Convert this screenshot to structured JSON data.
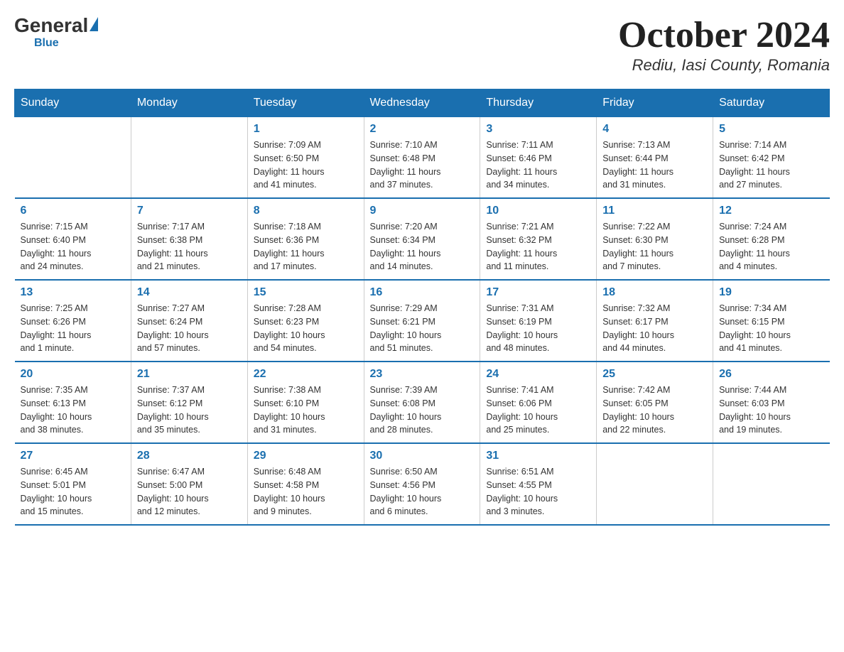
{
  "header": {
    "logo_general": "General",
    "logo_blue": "Blue",
    "month_title": "October 2024",
    "location": "Rediu, Iasi County, Romania"
  },
  "days_of_week": [
    "Sunday",
    "Monday",
    "Tuesday",
    "Wednesday",
    "Thursday",
    "Friday",
    "Saturday"
  ],
  "weeks": [
    [
      {
        "day": "",
        "info": ""
      },
      {
        "day": "",
        "info": ""
      },
      {
        "day": "1",
        "info": "Sunrise: 7:09 AM\nSunset: 6:50 PM\nDaylight: 11 hours\nand 41 minutes."
      },
      {
        "day": "2",
        "info": "Sunrise: 7:10 AM\nSunset: 6:48 PM\nDaylight: 11 hours\nand 37 minutes."
      },
      {
        "day": "3",
        "info": "Sunrise: 7:11 AM\nSunset: 6:46 PM\nDaylight: 11 hours\nand 34 minutes."
      },
      {
        "day": "4",
        "info": "Sunrise: 7:13 AM\nSunset: 6:44 PM\nDaylight: 11 hours\nand 31 minutes."
      },
      {
        "day": "5",
        "info": "Sunrise: 7:14 AM\nSunset: 6:42 PM\nDaylight: 11 hours\nand 27 minutes."
      }
    ],
    [
      {
        "day": "6",
        "info": "Sunrise: 7:15 AM\nSunset: 6:40 PM\nDaylight: 11 hours\nand 24 minutes."
      },
      {
        "day": "7",
        "info": "Sunrise: 7:17 AM\nSunset: 6:38 PM\nDaylight: 11 hours\nand 21 minutes."
      },
      {
        "day": "8",
        "info": "Sunrise: 7:18 AM\nSunset: 6:36 PM\nDaylight: 11 hours\nand 17 minutes."
      },
      {
        "day": "9",
        "info": "Sunrise: 7:20 AM\nSunset: 6:34 PM\nDaylight: 11 hours\nand 14 minutes."
      },
      {
        "day": "10",
        "info": "Sunrise: 7:21 AM\nSunset: 6:32 PM\nDaylight: 11 hours\nand 11 minutes."
      },
      {
        "day": "11",
        "info": "Sunrise: 7:22 AM\nSunset: 6:30 PM\nDaylight: 11 hours\nand 7 minutes."
      },
      {
        "day": "12",
        "info": "Sunrise: 7:24 AM\nSunset: 6:28 PM\nDaylight: 11 hours\nand 4 minutes."
      }
    ],
    [
      {
        "day": "13",
        "info": "Sunrise: 7:25 AM\nSunset: 6:26 PM\nDaylight: 11 hours\nand 1 minute."
      },
      {
        "day": "14",
        "info": "Sunrise: 7:27 AM\nSunset: 6:24 PM\nDaylight: 10 hours\nand 57 minutes."
      },
      {
        "day": "15",
        "info": "Sunrise: 7:28 AM\nSunset: 6:23 PM\nDaylight: 10 hours\nand 54 minutes."
      },
      {
        "day": "16",
        "info": "Sunrise: 7:29 AM\nSunset: 6:21 PM\nDaylight: 10 hours\nand 51 minutes."
      },
      {
        "day": "17",
        "info": "Sunrise: 7:31 AM\nSunset: 6:19 PM\nDaylight: 10 hours\nand 48 minutes."
      },
      {
        "day": "18",
        "info": "Sunrise: 7:32 AM\nSunset: 6:17 PM\nDaylight: 10 hours\nand 44 minutes."
      },
      {
        "day": "19",
        "info": "Sunrise: 7:34 AM\nSunset: 6:15 PM\nDaylight: 10 hours\nand 41 minutes."
      }
    ],
    [
      {
        "day": "20",
        "info": "Sunrise: 7:35 AM\nSunset: 6:13 PM\nDaylight: 10 hours\nand 38 minutes."
      },
      {
        "day": "21",
        "info": "Sunrise: 7:37 AM\nSunset: 6:12 PM\nDaylight: 10 hours\nand 35 minutes."
      },
      {
        "day": "22",
        "info": "Sunrise: 7:38 AM\nSunset: 6:10 PM\nDaylight: 10 hours\nand 31 minutes."
      },
      {
        "day": "23",
        "info": "Sunrise: 7:39 AM\nSunset: 6:08 PM\nDaylight: 10 hours\nand 28 minutes."
      },
      {
        "day": "24",
        "info": "Sunrise: 7:41 AM\nSunset: 6:06 PM\nDaylight: 10 hours\nand 25 minutes."
      },
      {
        "day": "25",
        "info": "Sunrise: 7:42 AM\nSunset: 6:05 PM\nDaylight: 10 hours\nand 22 minutes."
      },
      {
        "day": "26",
        "info": "Sunrise: 7:44 AM\nSunset: 6:03 PM\nDaylight: 10 hours\nand 19 minutes."
      }
    ],
    [
      {
        "day": "27",
        "info": "Sunrise: 6:45 AM\nSunset: 5:01 PM\nDaylight: 10 hours\nand 15 minutes."
      },
      {
        "day": "28",
        "info": "Sunrise: 6:47 AM\nSunset: 5:00 PM\nDaylight: 10 hours\nand 12 minutes."
      },
      {
        "day": "29",
        "info": "Sunrise: 6:48 AM\nSunset: 4:58 PM\nDaylight: 10 hours\nand 9 minutes."
      },
      {
        "day": "30",
        "info": "Sunrise: 6:50 AM\nSunset: 4:56 PM\nDaylight: 10 hours\nand 6 minutes."
      },
      {
        "day": "31",
        "info": "Sunrise: 6:51 AM\nSunset: 4:55 PM\nDaylight: 10 hours\nand 3 minutes."
      },
      {
        "day": "",
        "info": ""
      },
      {
        "day": "",
        "info": ""
      }
    ]
  ]
}
